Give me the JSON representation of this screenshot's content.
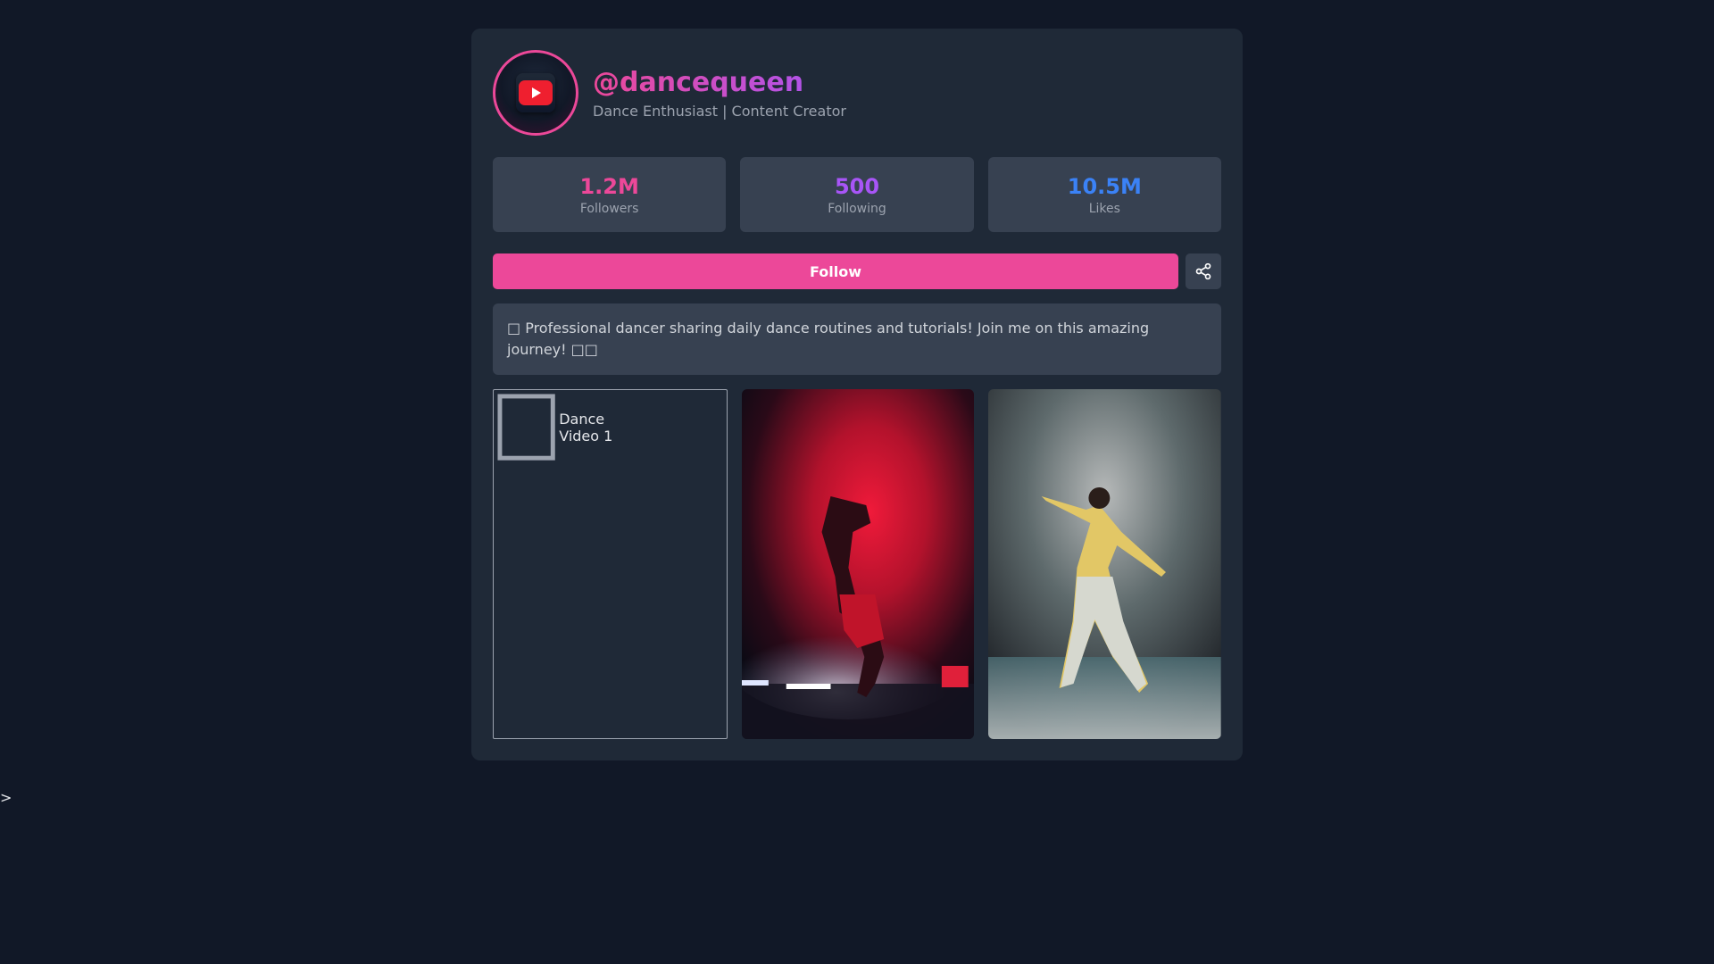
{
  "profile": {
    "handle": "@dancequeen",
    "tagline": "Dance Enthusiast | Content Creator",
    "avatar_icon": "youtube-play-icon"
  },
  "stats": [
    {
      "value": "1.2M",
      "label": "Followers",
      "color": "#ec4899"
    },
    {
      "value": "500",
      "label": "Following",
      "color": "#a855f7"
    },
    {
      "value": "10.5M",
      "label": "Likes",
      "color": "#3b82f6"
    }
  ],
  "actions": {
    "follow_label": "Follow",
    "share_icon": "share-icon"
  },
  "about": {
    "text": "□ Professional dancer sharing daily dance routines and tutorials! Join me on this amazing journey! □□"
  },
  "videos": [
    {
      "alt": "Dance Video 1"
    },
    {
      "alt": "Dance Video 2"
    },
    {
      "alt": "Dance Video 3"
    }
  ],
  "stray_text": ">",
  "colors": {
    "accent": "#ec4899",
    "background": "#111827",
    "card": "#1f2937",
    "panel": "#374151"
  }
}
